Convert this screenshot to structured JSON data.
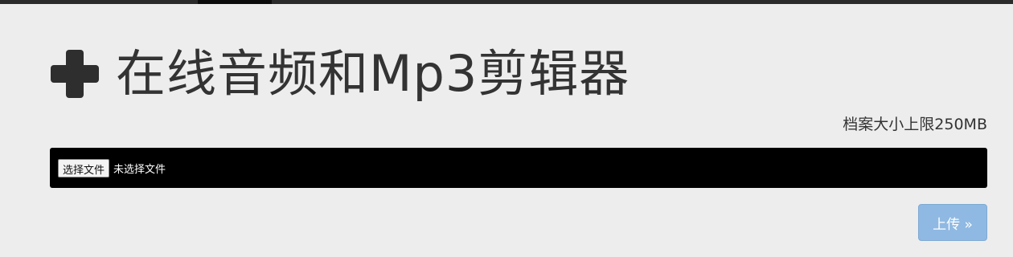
{
  "header": {
    "title": "在线音频和Mp3剪辑器",
    "icon": "plus-icon"
  },
  "upload_form": {
    "file_limit": "档案大小上限250MB",
    "choose_file_label": "选择文件",
    "no_file_text": "未选择文件",
    "upload_label": "上传 »"
  },
  "colors": {
    "page_background": "#ededed",
    "file_bar": "#000000",
    "upload_button": "#8fb9e2",
    "title_text": "#333333"
  }
}
